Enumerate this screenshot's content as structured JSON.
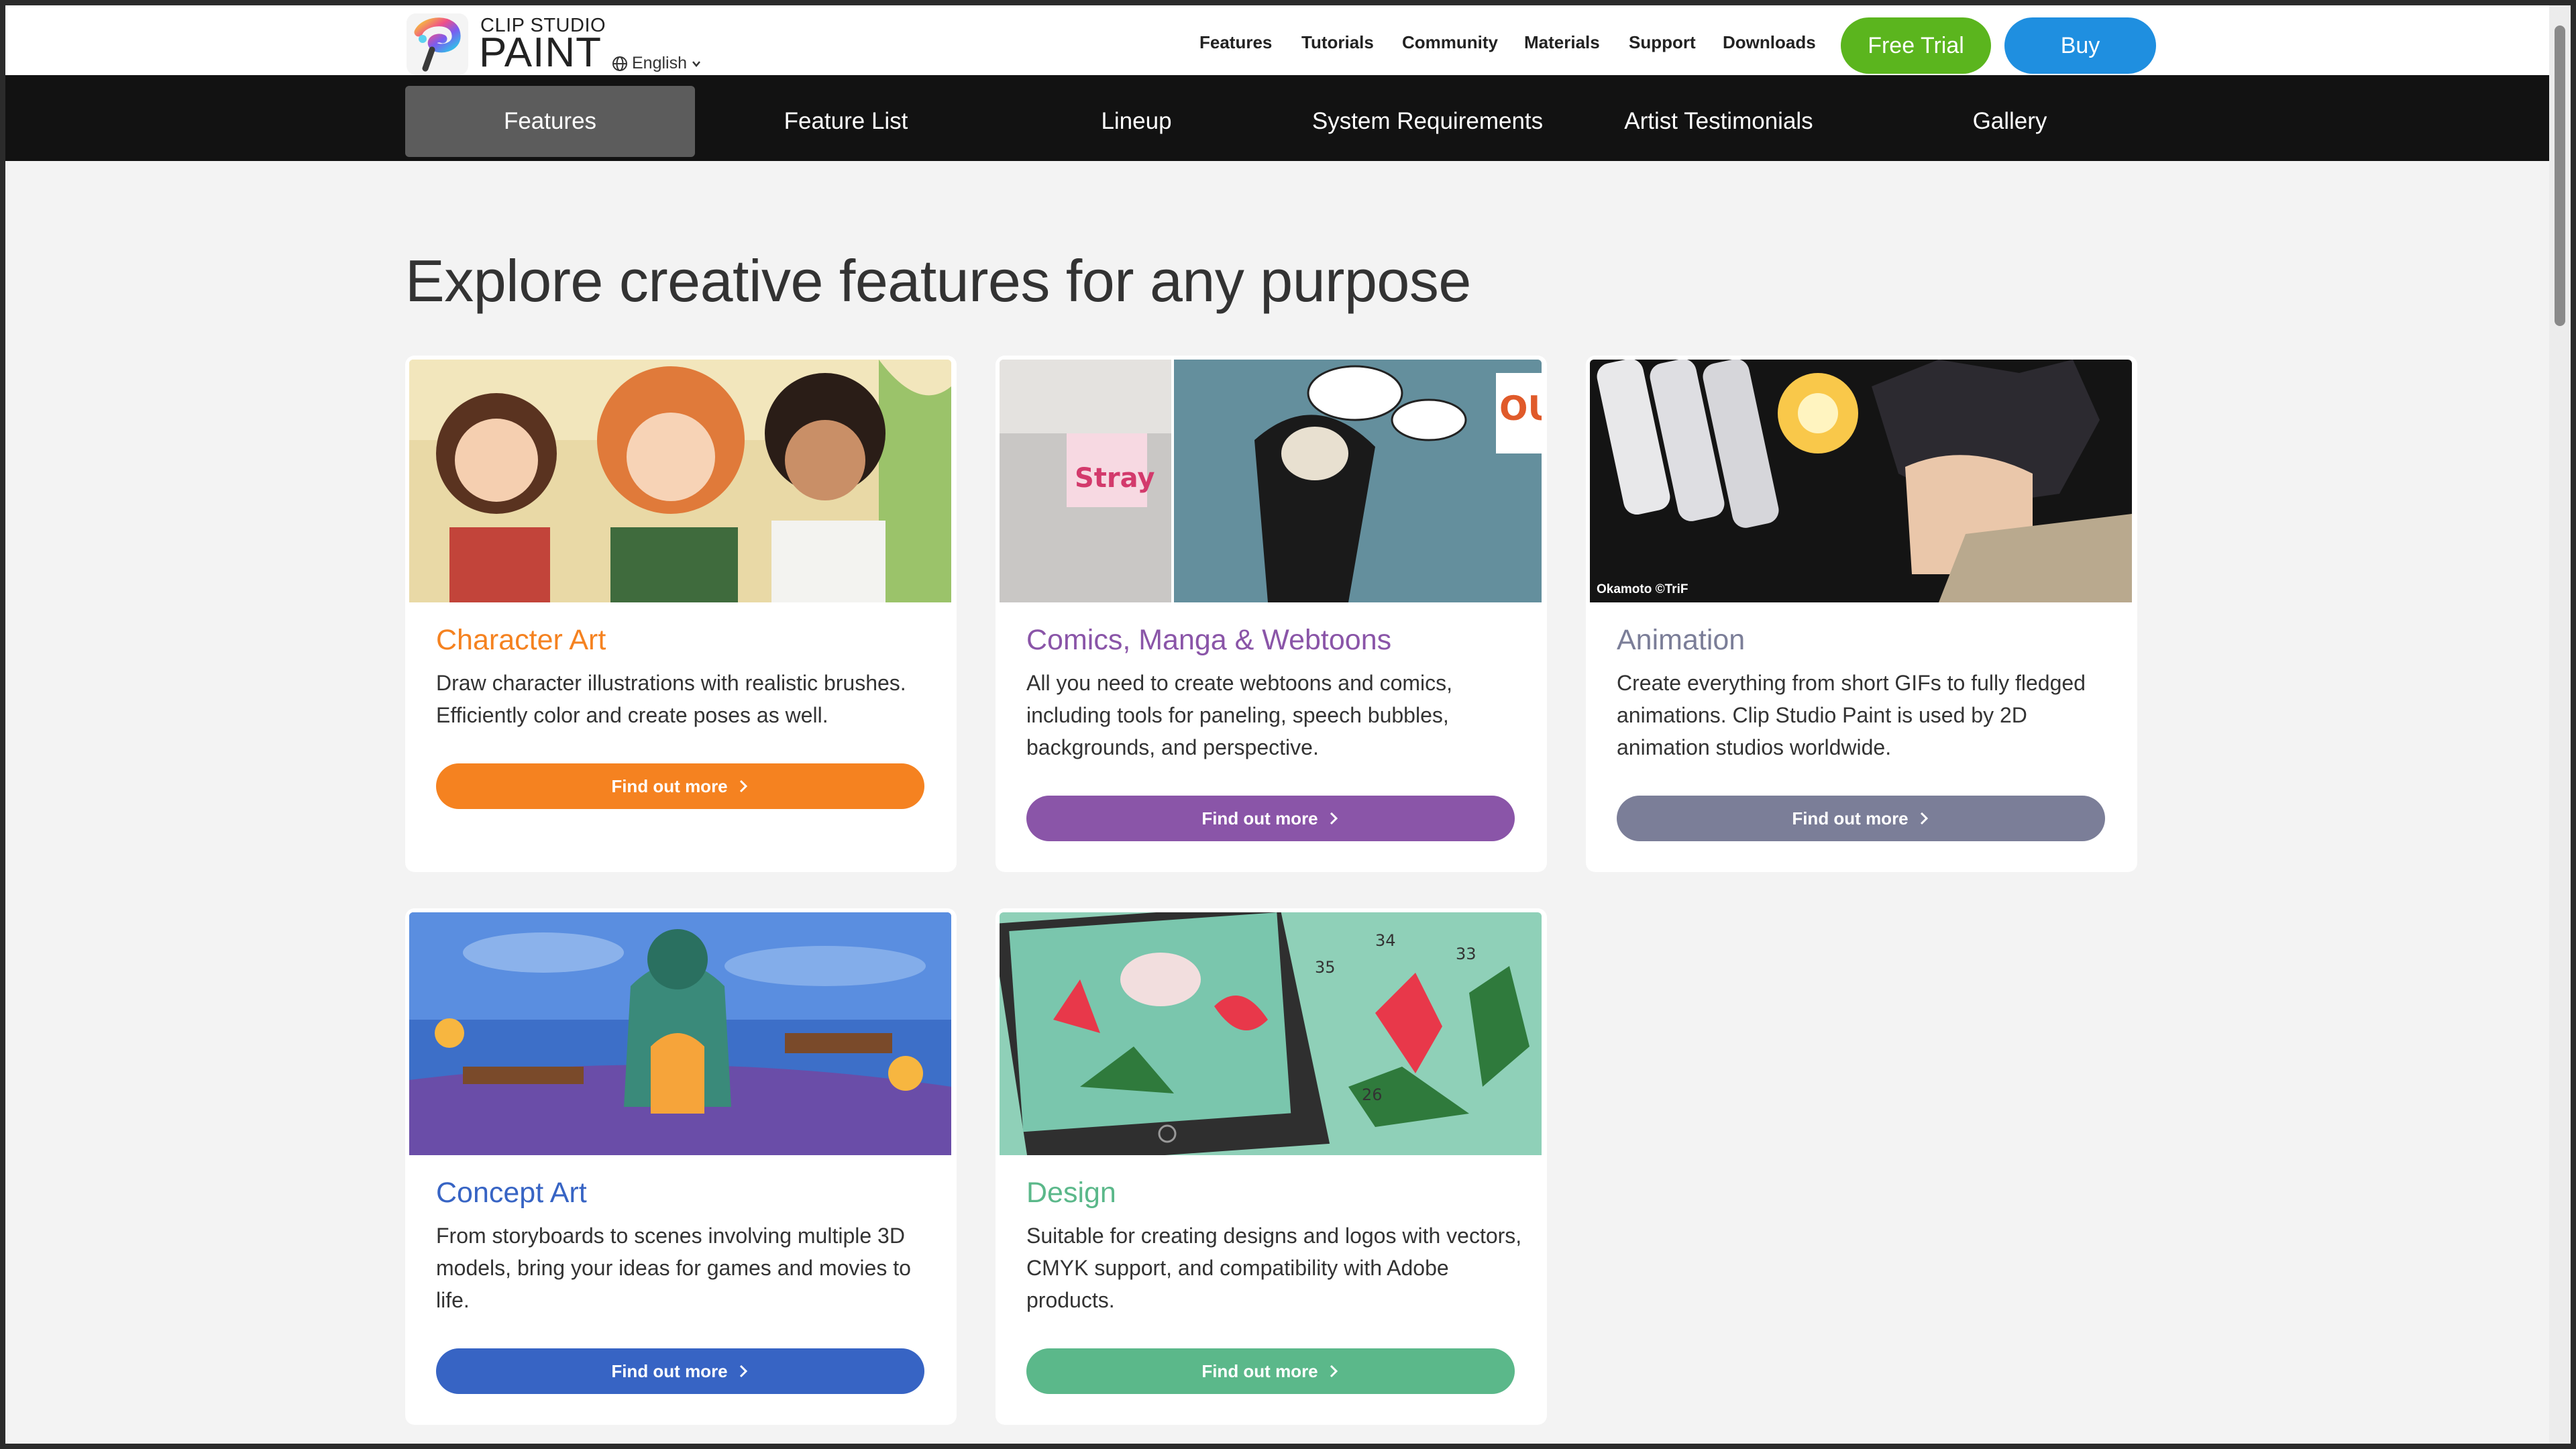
{
  "header": {
    "brand_top": "CLIP STUDIO",
    "brand_main": "PAINT",
    "language": "English",
    "nav": [
      "Features",
      "Tutorials",
      "Community",
      "Materials",
      "Support",
      "Downloads"
    ],
    "free_trial": "Free Trial",
    "buy": "Buy",
    "colors": {
      "trial": "#5bb51e",
      "buy": "#1f8fe0"
    }
  },
  "subnav": {
    "tabs": [
      "Features",
      "Feature List",
      "Lineup",
      "System Requirements",
      "Artist Testimonials",
      "Gallery"
    ],
    "active_index": 0
  },
  "main": {
    "title": "Explore creative features for any purpose",
    "cards": [
      {
        "title": "Character Art",
        "description": "Draw character illustrations with realistic brushes. Efficiently color and create poses as well.",
        "button": "Find out more",
        "color": "#f58220"
      },
      {
        "title": "Comics, Manga & Webtoons",
        "description": "All you need to create webtoons and comics, including tools for paneling, speech bubbles, backgrounds, and perspective.",
        "button": "Find out more",
        "color": "#8a55a8"
      },
      {
        "title": "Animation",
        "description": "Create everything from short GIFs to fully fledged animations. Clip Studio Paint is used by 2D animation studios worldwide.",
        "button": "Find out more",
        "color": "#7b7e98",
        "image_credit": "Okamoto ©TriF"
      },
      {
        "title": "Concept Art",
        "description": "From storyboards to scenes involving multiple 3D models, bring your ideas for games and movies to life.",
        "button": "Find out more",
        "color": "#3764c4"
      },
      {
        "title": "Design",
        "description": "Suitable for creating designs and logos with vectors, CMYK support, and compatibility with Adobe products.",
        "button": "Find out more",
        "color": "#5bb88a"
      }
    ]
  }
}
